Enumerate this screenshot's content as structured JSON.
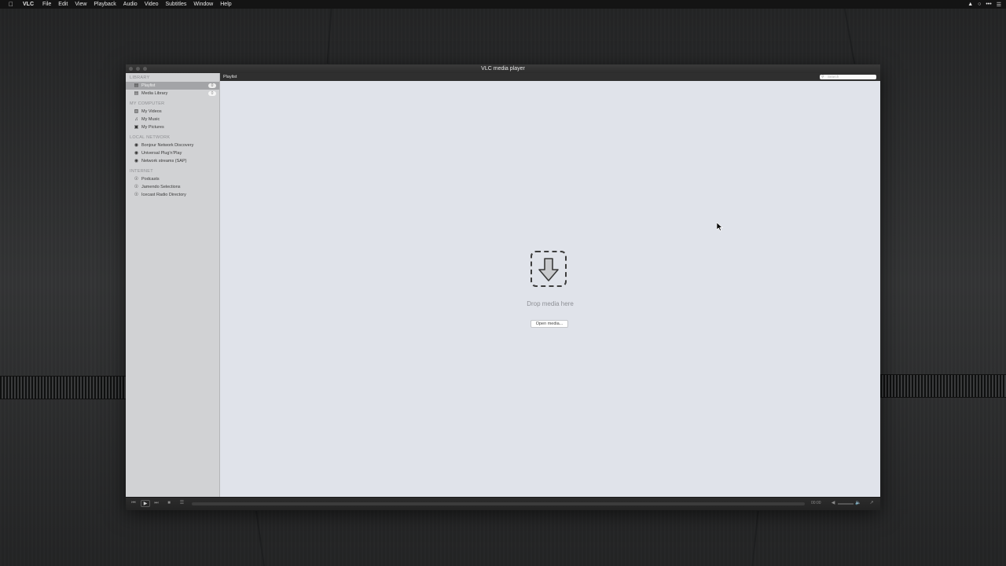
{
  "menubar": {
    "app": "VLC",
    "items": [
      "File",
      "Edit",
      "View",
      "Playback",
      "Audio",
      "Video",
      "Subtitles",
      "Window",
      "Help"
    ]
  },
  "window": {
    "title": "VLC media player"
  },
  "sidebar": {
    "sections": [
      {
        "title": "LIBRARY",
        "items": [
          {
            "label": "Playlist",
            "badge": "0",
            "icon": "playlist-icon",
            "selected": true
          },
          {
            "label": "Media Library",
            "badge": "0",
            "icon": "media-library-icon"
          }
        ]
      },
      {
        "title": "MY COMPUTER",
        "items": [
          {
            "label": "My Videos",
            "icon": "film-icon"
          },
          {
            "label": "My Music",
            "icon": "music-note-icon"
          },
          {
            "label": "My Pictures",
            "icon": "picture-icon"
          }
        ]
      },
      {
        "title": "LOCAL NETWORK",
        "items": [
          {
            "label": "Bonjour Network Discovery",
            "icon": "network-globe-icon"
          },
          {
            "label": "Universal Plug'n'Play",
            "icon": "network-globe-icon"
          },
          {
            "label": "Network streams (SAP)",
            "icon": "network-globe-icon"
          }
        ]
      },
      {
        "title": "INTERNET",
        "items": [
          {
            "label": "Podcasts",
            "icon": "podcast-icon"
          },
          {
            "label": "Jamendo Selections",
            "icon": "podcast-icon"
          },
          {
            "label": "Icecast Radio Directory",
            "icon": "podcast-icon"
          }
        ]
      }
    ]
  },
  "content": {
    "header_title": "Playlist",
    "search_placeholder": "Search",
    "drop_text": "Drop media here",
    "open_button": "Open media..."
  },
  "controls": {
    "time": "00:00"
  }
}
